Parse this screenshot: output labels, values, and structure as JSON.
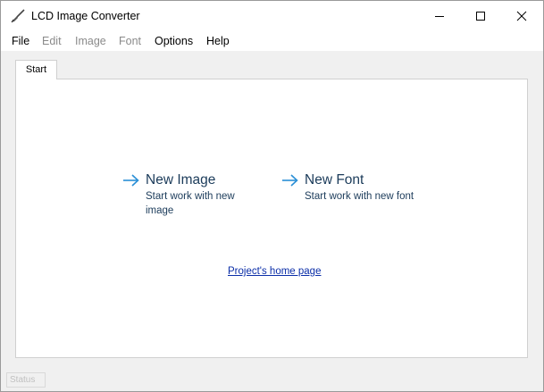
{
  "window": {
    "title": "LCD Image Converter",
    "icon": "broom-icon",
    "controls": [
      "minimize-icon",
      "maximize-icon",
      "close-icon"
    ]
  },
  "menu": [
    {
      "label": "File",
      "enabled": true
    },
    {
      "label": "Edit",
      "enabled": false
    },
    {
      "label": "Image",
      "enabled": false
    },
    {
      "label": "Font",
      "enabled": false
    },
    {
      "label": "Options",
      "enabled": true
    },
    {
      "label": "Help",
      "enabled": true
    }
  ],
  "tabs": [
    {
      "label": "Start",
      "active": true
    }
  ],
  "start": {
    "new_image": {
      "title": "New Image",
      "description": "Start work with new image"
    },
    "new_font": {
      "title": "New Font",
      "description": "Start work with new font"
    },
    "home_link": "Project's home page"
  },
  "status": {
    "text": "Status"
  },
  "colors": {
    "accent_arrow": "#2a8fd6",
    "action_text": "#1b3b5a",
    "link": "#0b2ea8",
    "disabled_menu": "#8a8a8a"
  }
}
